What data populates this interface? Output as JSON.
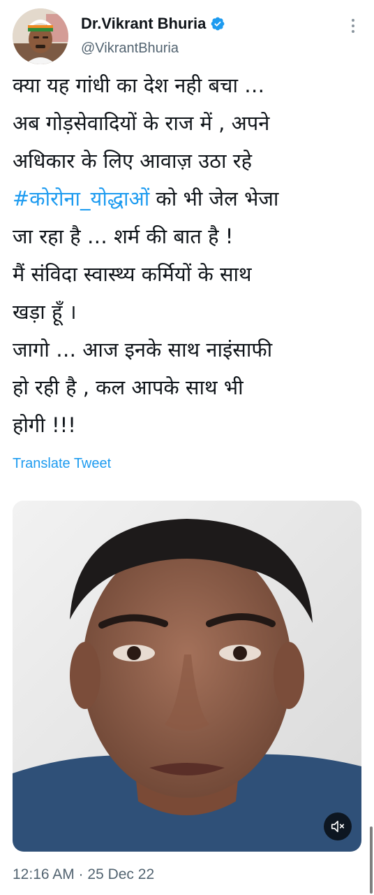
{
  "author": {
    "display_name": "Dr.Vikrant Bhuria",
    "handle": "@VikrantBhuria",
    "verified": true,
    "avatar_icon": "profile-photo"
  },
  "tweet": {
    "lines": [
      "क्या यह गांधी का देश नही बचा …",
      "अब गोड़सेवादियों के राज में , अपने",
      "अधिकार के लिए आवाज़ उठा रहे",
      "#कोरोना_योद्धाओं",
      " को भी जेल भेजा",
      "जा रहा है … शर्म की बात है !",
      "मैं संविदा स्वास्थ्य कर्मियों के साथ",
      "खड़ा हूँ ।",
      "जागो … आज इनके साथ नाइंसाफी",
      "हो रही है , कल आपके साथ भी",
      "होगी !!!"
    ],
    "translate_label": "Translate Tweet"
  },
  "media": {
    "type": "video",
    "mute_icon": "speaker-muted-icon"
  },
  "meta": {
    "timestamp": "12:16 AM · 25 Dec 22"
  },
  "colors": {
    "text": "#0f1419",
    "secondary": "#536471",
    "link": "#1d9bf0",
    "verified": "#1d9bf0"
  }
}
